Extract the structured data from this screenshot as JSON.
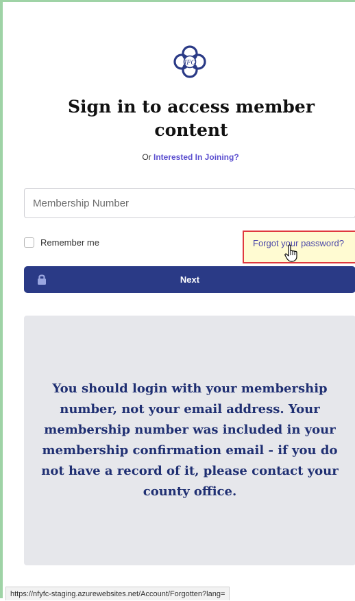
{
  "page": {
    "title": "Sign in to access member content",
    "subtitle_prefix": "Or",
    "join_link": "Interested In Joining?"
  },
  "form": {
    "membership_placeholder": "Membership Number",
    "membership_value": "",
    "remember_label": "Remember me",
    "remember_checked": false,
    "forgot_link": "Forgot your password?",
    "next_label": "Next"
  },
  "info": {
    "message": "You should login with your membership number, not your email address. Your membership number was included in your membership confirmation email - if you do not have a record of it, please contact your county office."
  },
  "status_bar": {
    "url": "https://nfyfc-staging.azurewebsites.net/Account/Forgotten?lang="
  },
  "icons": {
    "logo": "celtic-knot-logo-icon",
    "lock": "lock-icon",
    "cursor": "hand-pointer-icon"
  },
  "colors": {
    "brand_navy": "#2a3a86",
    "link_purple": "#5b4fcf",
    "highlight_border": "#e0393e",
    "highlight_fill": "#fffbd2",
    "panel_bg": "#e6e7eb",
    "frame_green": "#9fd3a6"
  }
}
